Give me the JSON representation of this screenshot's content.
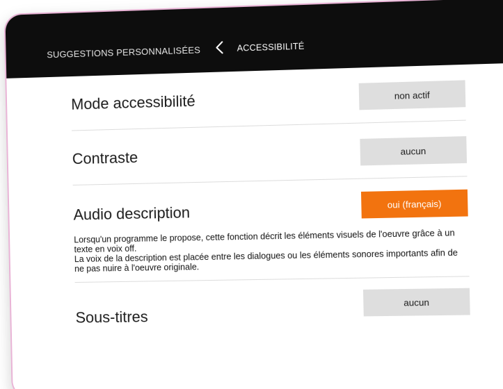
{
  "header": {
    "parent_label": "SUGGESTIONS PERSONNALISÉES",
    "current_label": "ACCESSIBILITÉ",
    "back_icon": "chevron-left-icon"
  },
  "settings": {
    "mode": {
      "label": "Mode accessibilité",
      "value": "non actif"
    },
    "contrast": {
      "label": "Contraste",
      "value": "aucun"
    },
    "audio": {
      "label": "Audio description",
      "value": "oui (français)",
      "description_line1": "Lorsqu'un programme le propose, cette fonction décrit les éléments visuels de l'oeuvre grâce à un texte en voix off.",
      "description_line2": "La voix de la description est placée entre les dialogues ou les éléments sonores importants afin de ne pas nuire à l'oeuvre originale."
    },
    "subtitles": {
      "label": "Sous-titres",
      "value": "aucun"
    }
  },
  "colors": {
    "header_bg": "#0d0d0d",
    "button_bg": "#dedede",
    "active_button_bg": "#f2730f",
    "device_border": "#e9b3d6"
  }
}
